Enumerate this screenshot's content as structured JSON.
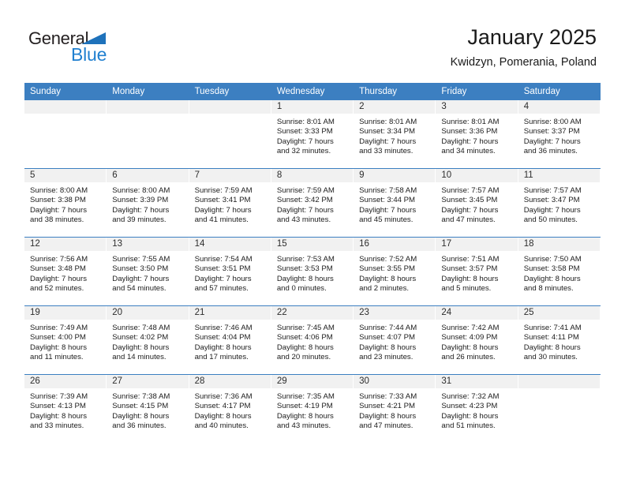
{
  "brand": {
    "name_part1": "General",
    "name_part2": "Blue",
    "triangle_icon": "triangle-icon",
    "color_dark": "#231f20",
    "color_blue": "#2180d0"
  },
  "header": {
    "title": "January 2025",
    "subtitle": "Kwidzyn, Pomerania, Poland"
  },
  "theme": {
    "header_bg": "#3c7fc1",
    "daynum_bg": "#f1f1f1",
    "text": "#1c1c1c"
  },
  "weekdays": [
    "Sunday",
    "Monday",
    "Tuesday",
    "Wednesday",
    "Thursday",
    "Friday",
    "Saturday"
  ],
  "weeks": [
    [
      {
        "day": "",
        "sunrise": "",
        "sunset": "",
        "daylight_line1": "",
        "daylight_line2": ""
      },
      {
        "day": "",
        "sunrise": "",
        "sunset": "",
        "daylight_line1": "",
        "daylight_line2": ""
      },
      {
        "day": "",
        "sunrise": "",
        "sunset": "",
        "daylight_line1": "",
        "daylight_line2": ""
      },
      {
        "day": "1",
        "sunrise": "Sunrise: 8:01 AM",
        "sunset": "Sunset: 3:33 PM",
        "daylight_line1": "Daylight: 7 hours",
        "daylight_line2": "and 32 minutes."
      },
      {
        "day": "2",
        "sunrise": "Sunrise: 8:01 AM",
        "sunset": "Sunset: 3:34 PM",
        "daylight_line1": "Daylight: 7 hours",
        "daylight_line2": "and 33 minutes."
      },
      {
        "day": "3",
        "sunrise": "Sunrise: 8:01 AM",
        "sunset": "Sunset: 3:36 PM",
        "daylight_line1": "Daylight: 7 hours",
        "daylight_line2": "and 34 minutes."
      },
      {
        "day": "4",
        "sunrise": "Sunrise: 8:00 AM",
        "sunset": "Sunset: 3:37 PM",
        "daylight_line1": "Daylight: 7 hours",
        "daylight_line2": "and 36 minutes."
      }
    ],
    [
      {
        "day": "5",
        "sunrise": "Sunrise: 8:00 AM",
        "sunset": "Sunset: 3:38 PM",
        "daylight_line1": "Daylight: 7 hours",
        "daylight_line2": "and 38 minutes."
      },
      {
        "day": "6",
        "sunrise": "Sunrise: 8:00 AM",
        "sunset": "Sunset: 3:39 PM",
        "daylight_line1": "Daylight: 7 hours",
        "daylight_line2": "and 39 minutes."
      },
      {
        "day": "7",
        "sunrise": "Sunrise: 7:59 AM",
        "sunset": "Sunset: 3:41 PM",
        "daylight_line1": "Daylight: 7 hours",
        "daylight_line2": "and 41 minutes."
      },
      {
        "day": "8",
        "sunrise": "Sunrise: 7:59 AM",
        "sunset": "Sunset: 3:42 PM",
        "daylight_line1": "Daylight: 7 hours",
        "daylight_line2": "and 43 minutes."
      },
      {
        "day": "9",
        "sunrise": "Sunrise: 7:58 AM",
        "sunset": "Sunset: 3:44 PM",
        "daylight_line1": "Daylight: 7 hours",
        "daylight_line2": "and 45 minutes."
      },
      {
        "day": "10",
        "sunrise": "Sunrise: 7:57 AM",
        "sunset": "Sunset: 3:45 PM",
        "daylight_line1": "Daylight: 7 hours",
        "daylight_line2": "and 47 minutes."
      },
      {
        "day": "11",
        "sunrise": "Sunrise: 7:57 AM",
        "sunset": "Sunset: 3:47 PM",
        "daylight_line1": "Daylight: 7 hours",
        "daylight_line2": "and 50 minutes."
      }
    ],
    [
      {
        "day": "12",
        "sunrise": "Sunrise: 7:56 AM",
        "sunset": "Sunset: 3:48 PM",
        "daylight_line1": "Daylight: 7 hours",
        "daylight_line2": "and 52 minutes."
      },
      {
        "day": "13",
        "sunrise": "Sunrise: 7:55 AM",
        "sunset": "Sunset: 3:50 PM",
        "daylight_line1": "Daylight: 7 hours",
        "daylight_line2": "and 54 minutes."
      },
      {
        "day": "14",
        "sunrise": "Sunrise: 7:54 AM",
        "sunset": "Sunset: 3:51 PM",
        "daylight_line1": "Daylight: 7 hours",
        "daylight_line2": "and 57 minutes."
      },
      {
        "day": "15",
        "sunrise": "Sunrise: 7:53 AM",
        "sunset": "Sunset: 3:53 PM",
        "daylight_line1": "Daylight: 8 hours",
        "daylight_line2": "and 0 minutes."
      },
      {
        "day": "16",
        "sunrise": "Sunrise: 7:52 AM",
        "sunset": "Sunset: 3:55 PM",
        "daylight_line1": "Daylight: 8 hours",
        "daylight_line2": "and 2 minutes."
      },
      {
        "day": "17",
        "sunrise": "Sunrise: 7:51 AM",
        "sunset": "Sunset: 3:57 PM",
        "daylight_line1": "Daylight: 8 hours",
        "daylight_line2": "and 5 minutes."
      },
      {
        "day": "18",
        "sunrise": "Sunrise: 7:50 AM",
        "sunset": "Sunset: 3:58 PM",
        "daylight_line1": "Daylight: 8 hours",
        "daylight_line2": "and 8 minutes."
      }
    ],
    [
      {
        "day": "19",
        "sunrise": "Sunrise: 7:49 AM",
        "sunset": "Sunset: 4:00 PM",
        "daylight_line1": "Daylight: 8 hours",
        "daylight_line2": "and 11 minutes."
      },
      {
        "day": "20",
        "sunrise": "Sunrise: 7:48 AM",
        "sunset": "Sunset: 4:02 PM",
        "daylight_line1": "Daylight: 8 hours",
        "daylight_line2": "and 14 minutes."
      },
      {
        "day": "21",
        "sunrise": "Sunrise: 7:46 AM",
        "sunset": "Sunset: 4:04 PM",
        "daylight_line1": "Daylight: 8 hours",
        "daylight_line2": "and 17 minutes."
      },
      {
        "day": "22",
        "sunrise": "Sunrise: 7:45 AM",
        "sunset": "Sunset: 4:06 PM",
        "daylight_line1": "Daylight: 8 hours",
        "daylight_line2": "and 20 minutes."
      },
      {
        "day": "23",
        "sunrise": "Sunrise: 7:44 AM",
        "sunset": "Sunset: 4:07 PM",
        "daylight_line1": "Daylight: 8 hours",
        "daylight_line2": "and 23 minutes."
      },
      {
        "day": "24",
        "sunrise": "Sunrise: 7:42 AM",
        "sunset": "Sunset: 4:09 PM",
        "daylight_line1": "Daylight: 8 hours",
        "daylight_line2": "and 26 minutes."
      },
      {
        "day": "25",
        "sunrise": "Sunrise: 7:41 AM",
        "sunset": "Sunset: 4:11 PM",
        "daylight_line1": "Daylight: 8 hours",
        "daylight_line2": "and 30 minutes."
      }
    ],
    [
      {
        "day": "26",
        "sunrise": "Sunrise: 7:39 AM",
        "sunset": "Sunset: 4:13 PM",
        "daylight_line1": "Daylight: 8 hours",
        "daylight_line2": "and 33 minutes."
      },
      {
        "day": "27",
        "sunrise": "Sunrise: 7:38 AM",
        "sunset": "Sunset: 4:15 PM",
        "daylight_line1": "Daylight: 8 hours",
        "daylight_line2": "and 36 minutes."
      },
      {
        "day": "28",
        "sunrise": "Sunrise: 7:36 AM",
        "sunset": "Sunset: 4:17 PM",
        "daylight_line1": "Daylight: 8 hours",
        "daylight_line2": "and 40 minutes."
      },
      {
        "day": "29",
        "sunrise": "Sunrise: 7:35 AM",
        "sunset": "Sunset: 4:19 PM",
        "daylight_line1": "Daylight: 8 hours",
        "daylight_line2": "and 43 minutes."
      },
      {
        "day": "30",
        "sunrise": "Sunrise: 7:33 AM",
        "sunset": "Sunset: 4:21 PM",
        "daylight_line1": "Daylight: 8 hours",
        "daylight_line2": "and 47 minutes."
      },
      {
        "day": "31",
        "sunrise": "Sunrise: 7:32 AM",
        "sunset": "Sunset: 4:23 PM",
        "daylight_line1": "Daylight: 8 hours",
        "daylight_line2": "and 51 minutes."
      },
      {
        "day": "",
        "sunrise": "",
        "sunset": "",
        "daylight_line1": "",
        "daylight_line2": ""
      }
    ]
  ]
}
